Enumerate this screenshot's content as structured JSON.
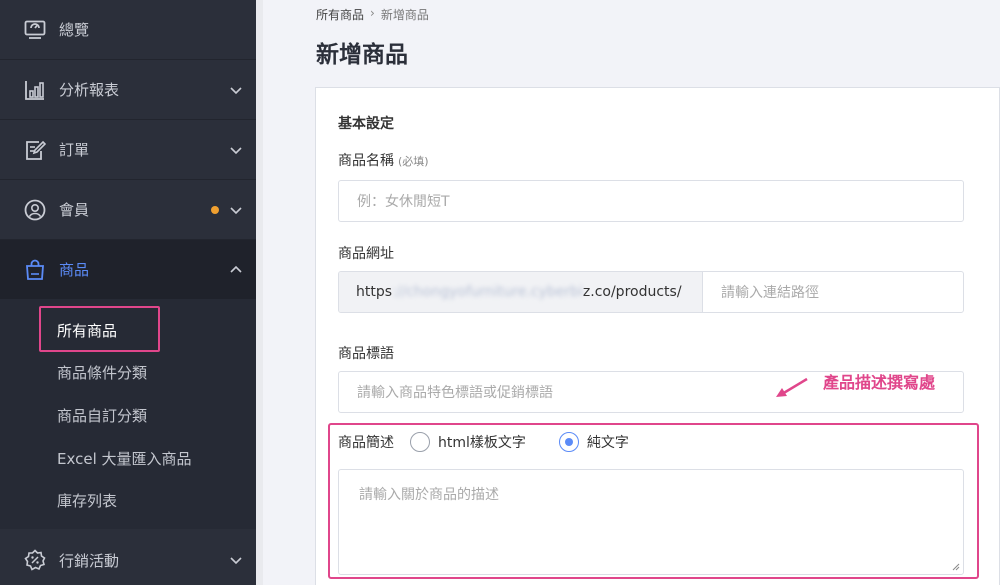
{
  "sidebar": {
    "items": [
      {
        "label": "總覽",
        "icon": "dashboard-icon"
      },
      {
        "label": "分析報表",
        "icon": "bar-chart-icon"
      },
      {
        "label": "訂單",
        "icon": "order-edit-icon"
      },
      {
        "label": "會員",
        "icon": "user-circle-icon"
      },
      {
        "label": "商品",
        "icon": "shopping-bag-icon"
      },
      {
        "label": "行銷活動",
        "icon": "discount-badge-icon"
      }
    ],
    "sub_items": [
      {
        "label": "所有商品"
      },
      {
        "label": "商品條件分類"
      },
      {
        "label": "商品自訂分類"
      },
      {
        "label": "Excel 大量匯入商品"
      },
      {
        "label": "庫存列表"
      }
    ]
  },
  "breadcrumb": {
    "parent": "所有商品",
    "separator": "›",
    "current": "新增商品"
  },
  "page_title": "新增商品",
  "form": {
    "section_title": "基本設定",
    "name": {
      "label": "商品名稱",
      "hint": "(必填)",
      "placeholder": "例：女休閒短T"
    },
    "url": {
      "label": "商品網址",
      "prefix_start": "https",
      "prefix_blurred": "://chongyofurniture.cyberbi",
      "prefix_end": "z.co/products/",
      "placeholder": "請輸入連結路徑"
    },
    "slogan": {
      "label": "商品標語",
      "placeholder": "請輸入商品特色標語或促銷標語"
    },
    "description": {
      "label": "商品簡述",
      "options": [
        {
          "label": "html樣板文字",
          "checked": false
        },
        {
          "label": "純文字",
          "checked": true
        }
      ],
      "placeholder": "請輸入關於商品的描述"
    }
  },
  "annotation": {
    "text": "產品描述撰寫處"
  },
  "colors": {
    "accent": "#5b8bf7",
    "highlight": "#e0468b",
    "sidebar_bg": "#2b2f3a",
    "badge": "#f0a030"
  }
}
